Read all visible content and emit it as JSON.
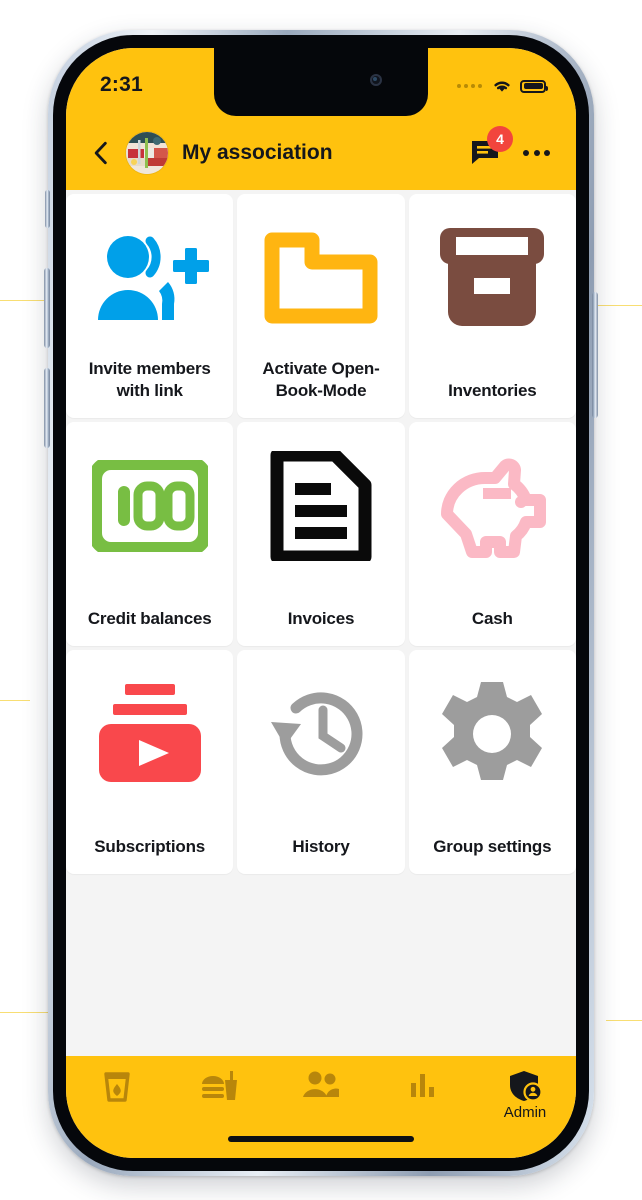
{
  "status_bar": {
    "time": "2:31",
    "signal_icon": "signal-dots-icon",
    "wifi_icon": "wifi-icon",
    "battery_icon": "battery-full-icon"
  },
  "header": {
    "back_icon": "back-chevron-icon",
    "avatar_icon": "group-avatar-photo",
    "title": "My association",
    "chat_icon": "chat-bubble-icon",
    "chat_badge": "4",
    "menu_icon": "overflow-menu-icon",
    "background_color": "#FFC20E",
    "badge_color": "#F2453D"
  },
  "grid": {
    "items": [
      {
        "id": "invite-members",
        "label": "Invite members with link",
        "icon": "person-add-icon",
        "color": "#00A0E9"
      },
      {
        "id": "open-book-mode",
        "label": "Activate Open-Book-Mode",
        "icon": "folder-outline-icon",
        "color": "#FFB511"
      },
      {
        "id": "inventories",
        "label": "Inventories",
        "icon": "archive-box-icon",
        "color": "#7A4C40"
      },
      {
        "id": "credit-balances",
        "label": "Credit balances",
        "icon": "banknote-100-icon",
        "color": "#78BE43"
      },
      {
        "id": "invoices",
        "label": "Invoices",
        "icon": "document-lines-icon",
        "color": "#0A0A0A"
      },
      {
        "id": "cash",
        "label": "Cash",
        "icon": "piggy-bank-icon",
        "color": "#FBB9C5"
      },
      {
        "id": "subscriptions",
        "label": "Subscriptions",
        "icon": "subscriptions-play-icon",
        "color": "#F9484C"
      },
      {
        "id": "history",
        "label": "History",
        "icon": "history-clock-icon",
        "color": "#9D9D9D"
      },
      {
        "id": "group-settings",
        "label": "Group settings",
        "icon": "gear-icon",
        "color": "#9D9D9D"
      }
    ]
  },
  "bottom_nav": {
    "items": [
      {
        "id": "drinks",
        "icon": "drink-glass-icon",
        "label": "",
        "active": false
      },
      {
        "id": "food",
        "icon": "food-meal-icon",
        "label": "",
        "active": false
      },
      {
        "id": "members",
        "icon": "people-group-icon",
        "label": "",
        "active": false
      },
      {
        "id": "stats",
        "icon": "bar-chart-icon",
        "label": "",
        "active": false
      },
      {
        "id": "admin",
        "icon": "shield-admin-icon",
        "label": "Admin",
        "active": true
      }
    ],
    "inactive_color": "#B8860B",
    "active_color": "#15171C",
    "background_color": "#FFC20E"
  }
}
